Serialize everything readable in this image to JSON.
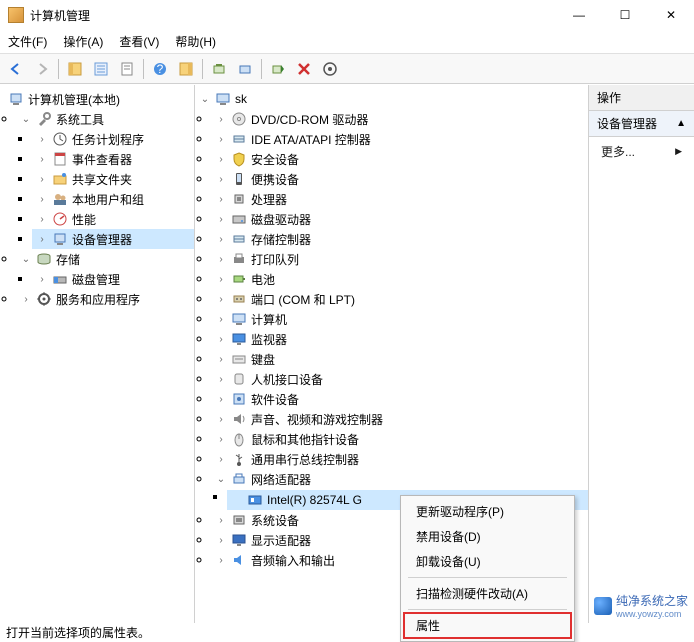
{
  "window": {
    "title": "计算机管理",
    "minimize": "—",
    "maximize": "☐",
    "close": "✕"
  },
  "menubar": {
    "file": "文件(F)",
    "action": "操作(A)",
    "view": "查看(V)",
    "help": "帮助(H)"
  },
  "left_tree": {
    "root": "计算机管理(本地)",
    "nodes": [
      {
        "label": "系统工具",
        "expanded": true,
        "children": [
          {
            "label": "任务计划程序"
          },
          {
            "label": "事件查看器"
          },
          {
            "label": "共享文件夹"
          },
          {
            "label": "本地用户和组"
          },
          {
            "label": "性能"
          },
          {
            "label": "设备管理器",
            "selected": true
          }
        ]
      },
      {
        "label": "存储",
        "expanded": true,
        "children": [
          {
            "label": "磁盘管理"
          }
        ]
      },
      {
        "label": "服务和应用程序",
        "expanded": false
      }
    ]
  },
  "device_tree": {
    "root": "sk",
    "categories": [
      {
        "label": "DVD/CD-ROM 驱动器",
        "icon": "disc"
      },
      {
        "label": "IDE ATA/ATAPI 控制器",
        "icon": "ctrl"
      },
      {
        "label": "安全设备",
        "icon": "shield"
      },
      {
        "label": "便携设备",
        "icon": "portable"
      },
      {
        "label": "处理器",
        "icon": "cpu"
      },
      {
        "label": "磁盘驱动器",
        "icon": "disk"
      },
      {
        "label": "存储控制器",
        "icon": "ctrl"
      },
      {
        "label": "打印队列",
        "icon": "printer"
      },
      {
        "label": "电池",
        "icon": "battery"
      },
      {
        "label": "端口 (COM 和 LPT)",
        "icon": "port"
      },
      {
        "label": "计算机",
        "icon": "computer"
      },
      {
        "label": "监视器",
        "icon": "monitor"
      },
      {
        "label": "键盘",
        "icon": "keyboard"
      },
      {
        "label": "人机接口设备",
        "icon": "hid"
      },
      {
        "label": "软件设备",
        "icon": "soft"
      },
      {
        "label": "声音、视频和游戏控制器",
        "icon": "sound"
      },
      {
        "label": "鼠标和其他指针设备",
        "icon": "mouse"
      },
      {
        "label": "通用串行总线控制器",
        "icon": "usb"
      },
      {
        "label": "网络适配器",
        "icon": "net",
        "expanded": true,
        "children": [
          {
            "label": "Intel(R) 82574L G",
            "selected": true
          }
        ]
      },
      {
        "label": "系统设备",
        "icon": "sys"
      },
      {
        "label": "显示适配器",
        "icon": "display"
      },
      {
        "label": "音频输入和输出",
        "icon": "audio"
      }
    ]
  },
  "right_panel": {
    "header": "操作",
    "section": "设备管理器",
    "more": "更多..."
  },
  "context_menu": {
    "items": [
      {
        "label": "更新驱动程序(P)"
      },
      {
        "label": "禁用设备(D)"
      },
      {
        "label": "卸载设备(U)"
      },
      {
        "sep": true
      },
      {
        "label": "扫描检测硬件改动(A)"
      },
      {
        "sep": true
      },
      {
        "label": "属性",
        "highlight": true
      }
    ]
  },
  "statusbar": "打开当前选择项的属性表。",
  "watermark": {
    "text": "纯净系统之家",
    "url": "www.yowzy.com"
  }
}
